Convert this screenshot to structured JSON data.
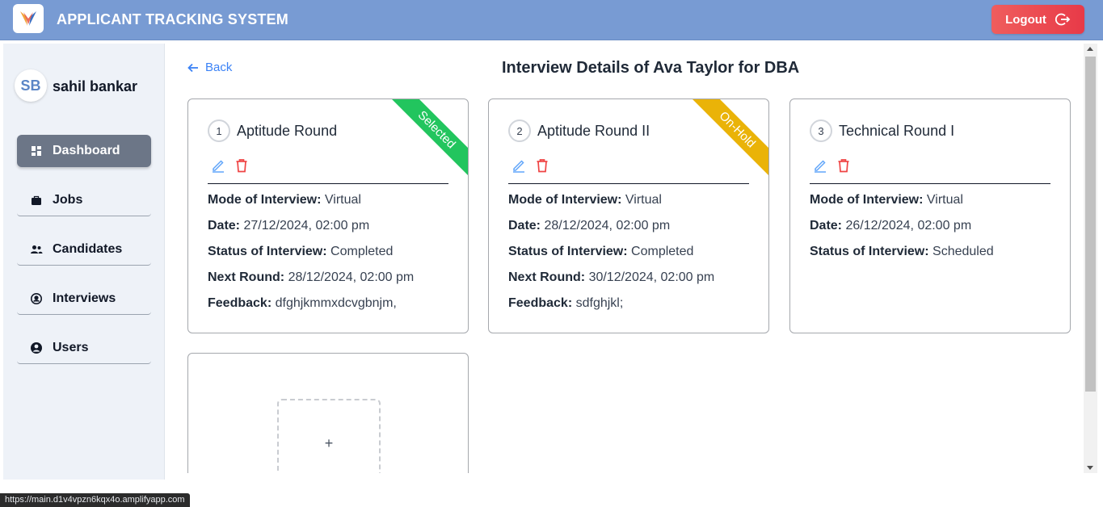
{
  "header": {
    "title": "APPLICANT TRACKING SYSTEM",
    "logout_label": "Logout",
    "accent_color": "#789bd3",
    "logout_color": "#e83a48"
  },
  "sidebar": {
    "avatar_initials": "SB",
    "user_name": "sahil bankar",
    "items": [
      {
        "label": "Dashboard",
        "icon": "dashboard-icon",
        "active": true
      },
      {
        "label": "Jobs",
        "icon": "briefcase-icon",
        "active": false
      },
      {
        "label": "Candidates",
        "icon": "users-icon",
        "active": false
      },
      {
        "label": "Interviews",
        "icon": "interview-icon",
        "active": false
      },
      {
        "label": "Users",
        "icon": "user-circle-icon",
        "active": false
      }
    ]
  },
  "main": {
    "back_label": "Back",
    "title": "Interview Details of Ava Taylor for DBA",
    "cards": [
      {
        "number": "1",
        "name": "Aptitude Round",
        "ribbon": "Selected",
        "ribbon_color": "#22c55e",
        "mode_label": "Mode of Interview:",
        "mode": "Virtual",
        "date_label": "Date:",
        "date": "27/12/2024, 02:00 pm",
        "status_label": "Status of Interview:",
        "status": "Completed",
        "next_label": "Next Round:",
        "next": "28/12/2024, 02:00 pm",
        "feedback_label": "Feedback:",
        "feedback": "dfghjkmmxdcvgbnjm,"
      },
      {
        "number": "2",
        "name": "Aptitude Round II",
        "ribbon": "On-Hold",
        "ribbon_color": "#eab308",
        "mode_label": "Mode of Interview:",
        "mode": "Virtual",
        "date_label": "Date:",
        "date": "28/12/2024, 02:00 pm",
        "status_label": "Status of Interview:",
        "status": "Completed",
        "next_label": "Next Round:",
        "next": "30/12/2024, 02:00 pm",
        "feedback_label": "Feedback:",
        "feedback": "sdfghjkl;"
      },
      {
        "number": "3",
        "name": "Technical Round I",
        "mode_label": "Mode of Interview:",
        "mode": "Virtual",
        "date_label": "Date:",
        "date": "26/12/2024, 02:00 pm",
        "status_label": "Status of Interview:",
        "status": "Scheduled"
      }
    ],
    "add_label": "+"
  },
  "status_bar": {
    "url": "https://main.d1v4vpzn6kqx4o.amplifyapp.com"
  }
}
